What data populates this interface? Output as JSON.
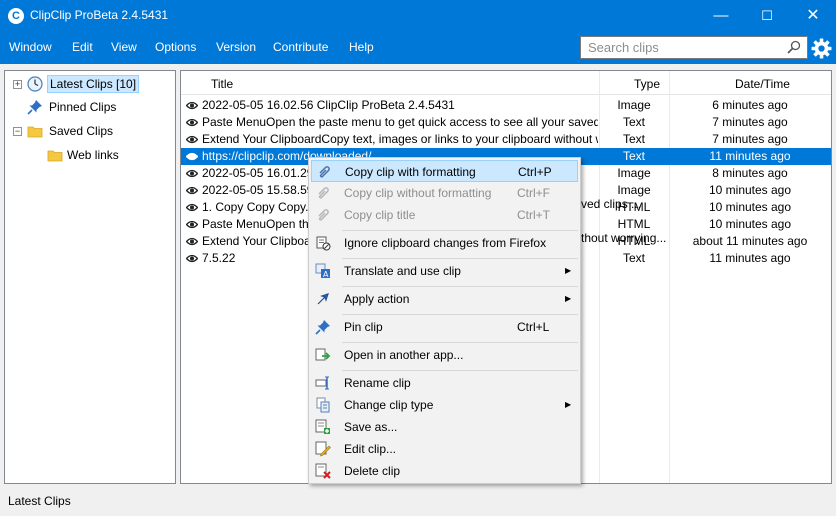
{
  "window": {
    "title": "ClipClip ProBeta 2.4.5431",
    "icon_letter": "C"
  },
  "window_controls": {
    "minimize": "—",
    "maximize": "☐",
    "close": "✕"
  },
  "menu": [
    "Window",
    "Edit",
    "View",
    "Options",
    "Version",
    "Contribute",
    "Help"
  ],
  "search": {
    "placeholder": "Search clips"
  },
  "tree": {
    "latest": "Latest Clips [10]",
    "pinned": "Pinned Clips",
    "saved": "Saved Clips",
    "weblinks": "Web links",
    "expand_plus": "+",
    "expand_minus": "−"
  },
  "columns": {
    "title": "Title",
    "type": "Type",
    "date": "Date/Time"
  },
  "rows": [
    {
      "title": "2022-05-05 16.02.56 ClipClip ProBeta 2.4.5431",
      "type": "Image",
      "date": "6 minutes ago"
    },
    {
      "title": "Paste MenuOpen the paste menu to get quick access to see all your saved clips ...",
      "type": "Text",
      "date": "7 minutes ago"
    },
    {
      "title": "Extend Your ClipboardCopy text, images or links to your clipboard without worrying...",
      "type": "Text",
      "date": "7 minutes ago"
    },
    {
      "title": "https://clipclip.com/downloaded/",
      "type": "Text",
      "date": "11 minutes ago"
    },
    {
      "title": "2022-05-05 16.01.29 C",
      "type": "Image",
      "date": "8 minutes ago"
    },
    {
      "title": "2022-05-05 15.58.59 C",
      "type": "Image",
      "date": "10 minutes ago"
    },
    {
      "title": "1. Copy Copy Copy...C",
      "type": "HTML",
      "date": "10 minutes ago"
    },
    {
      "title": "Paste MenuOpen the p",
      "type": "HTML",
      "date": "10 minutes ago"
    },
    {
      "title": "Extend Your Clipboard",
      "type": "HTML",
      "date": "about 11 minutes ago"
    },
    {
      "title": "7.5.22",
      "type": "Text",
      "date": "11 minutes ago"
    }
  ],
  "row_overflow": {
    "r4": "d",
    "r5": "d",
    "r6": "d",
    "r7": "ved clips ...",
    "r8": "thout worrying..."
  },
  "context_menu": {
    "copy_formatted": "Copy clip with formatting",
    "copy_formatted_sc": "Ctrl+P",
    "copy_plain": "Copy clip without formatting",
    "copy_plain_sc": "Ctrl+F",
    "copy_title": "Copy clip title",
    "copy_title_sc": "Ctrl+T",
    "ignore": "Ignore clipboard changes from Firefox",
    "translate": "Translate and use clip",
    "apply_action": "Apply action",
    "pin": "Pin clip",
    "pin_sc": "Ctrl+L",
    "open_other": "Open in another app...",
    "rename": "Rename clip",
    "change_type": "Change clip type",
    "save_as": "Save as...",
    "edit": "Edit clip...",
    "delete": "Delete clip",
    "arrow": "▶"
  },
  "status": {
    "text": "Latest Clips"
  },
  "colors": {
    "accent": "#0078d7",
    "selection": "#0078d7",
    "menu_highlight": "#cce8ff"
  }
}
